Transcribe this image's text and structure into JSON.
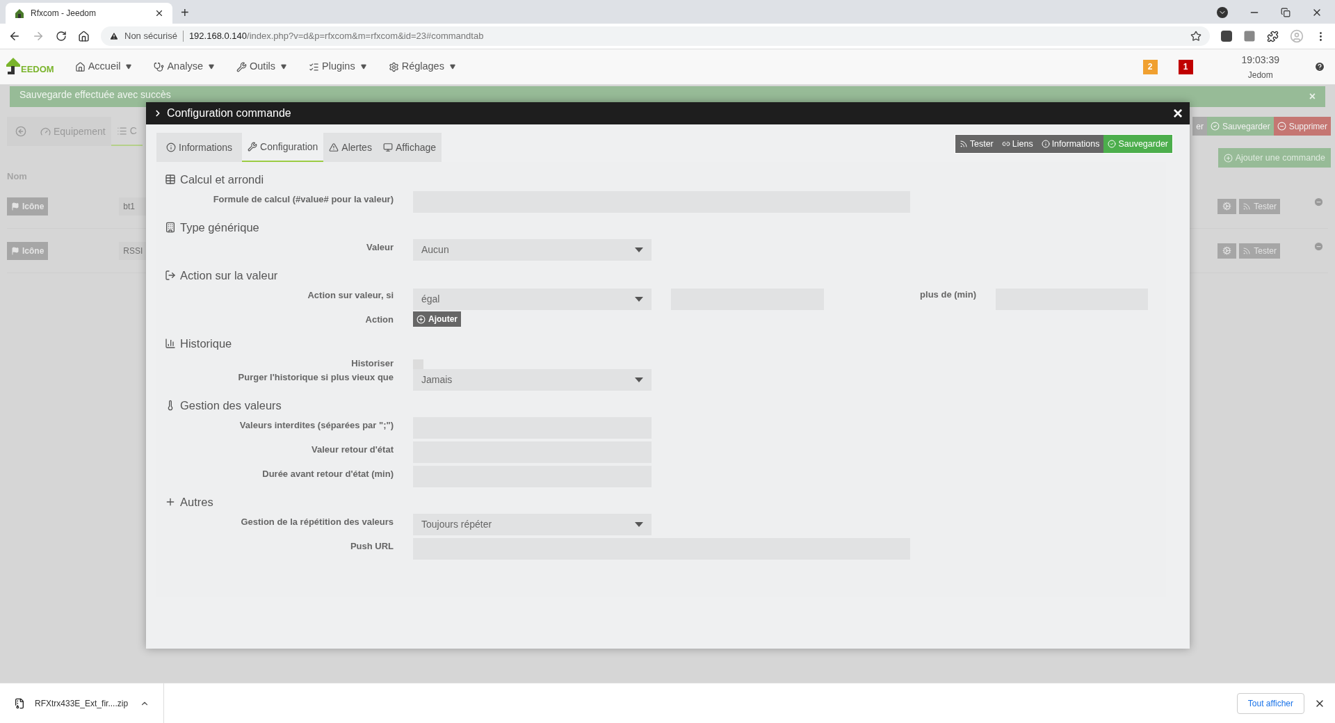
{
  "browser": {
    "tab_title": "Rfxcom - Jeedom",
    "new_tab": "+",
    "security": "Non sécurisé",
    "url_host": "192.168.0.140",
    "url_path": "/index.php?v=d&p=rfxcom&m=rfxcom&id=23#commandtab"
  },
  "nav": {
    "logo_text": "EEDOM",
    "menus": [
      "Accueil",
      "Analyse",
      "Outils",
      "Plugins",
      "Réglages"
    ],
    "badges": [
      {
        "text": "2",
        "color": "#f0a030"
      },
      {
        "text": "1",
        "color": "#c00000"
      }
    ],
    "time": "19:03:39",
    "user": "Jedom"
  },
  "background": {
    "notification": "Sauvegarde effectuée avec succès",
    "notification_close": "×",
    "tabs": [
      {
        "label": "Equipement",
        "selected": false
      },
      {
        "label": "C",
        "selected": true
      }
    ],
    "actions": [
      {
        "label": "er",
        "kind": "neutral"
      },
      {
        "label": "Sauvegarder",
        "kind": "success"
      },
      {
        "label": "Supprimer",
        "kind": "danger"
      }
    ],
    "add_command": "Ajouter une commande",
    "column": "Nom",
    "rows": [
      {
        "icon_button": "Icône",
        "name": "bt1",
        "test": "Tester"
      },
      {
        "icon_button": "Icône",
        "name": "RSSI",
        "test": "Tester"
      }
    ]
  },
  "modal": {
    "title": "Configuration commande",
    "close": "×",
    "tabs": [
      {
        "label": "Informations",
        "selected": false
      },
      {
        "label": "Configuration",
        "selected": true
      },
      {
        "label": "Alertes",
        "selected": false
      },
      {
        "label": "Affichage",
        "selected": false
      }
    ],
    "actions": [
      {
        "label": "Tester",
        "kind": "neutral"
      },
      {
        "label": "Liens",
        "kind": "neutral"
      },
      {
        "label": "Informations",
        "kind": "neutral"
      },
      {
        "label": "Sauvegarder",
        "kind": "success"
      }
    ],
    "sections": [
      {
        "title": "Calcul et arrondi",
        "fields": [
          {
            "label": "Formule de calcul (#value# pour la valeur)",
            "kind": "wide"
          }
        ]
      },
      {
        "title": "Type générique",
        "fields": [
          {
            "label": "Valeur",
            "kind": "select",
            "value": "Aucun"
          }
        ]
      },
      {
        "title": "Action sur la valeur",
        "fields": [
          {
            "label": "Action sur valeur, si",
            "kind": "condition",
            "value": "égal",
            "extra_label": "plus de (min)"
          },
          {
            "label": "Action",
            "kind": "button",
            "value": "Ajouter"
          }
        ]
      },
      {
        "title": "Historique",
        "fields": [
          {
            "label": "Historiser",
            "kind": "checkbox",
            "checked": false
          },
          {
            "label": "Purger l'historique si plus vieux que",
            "kind": "select",
            "value": "Jamais"
          }
        ]
      },
      {
        "title": "Gestion des valeurs",
        "fields": [
          {
            "label": "Valeurs interdites (séparées par \";\")",
            "kind": "input"
          },
          {
            "label": "Valeur retour d'état",
            "kind": "input"
          },
          {
            "label": "Durée avant retour d'état (min)",
            "kind": "input"
          }
        ]
      },
      {
        "title": "Autres",
        "fields": [
          {
            "label": "Gestion de la répétition des valeurs",
            "kind": "select",
            "value": "Toujours répéter"
          },
          {
            "label": "Push URL",
            "kind": "wide"
          }
        ]
      }
    ]
  },
  "downloads": {
    "file": "RFXtrx433E_Ext_fir....zip",
    "show_all": "Tout afficher"
  }
}
